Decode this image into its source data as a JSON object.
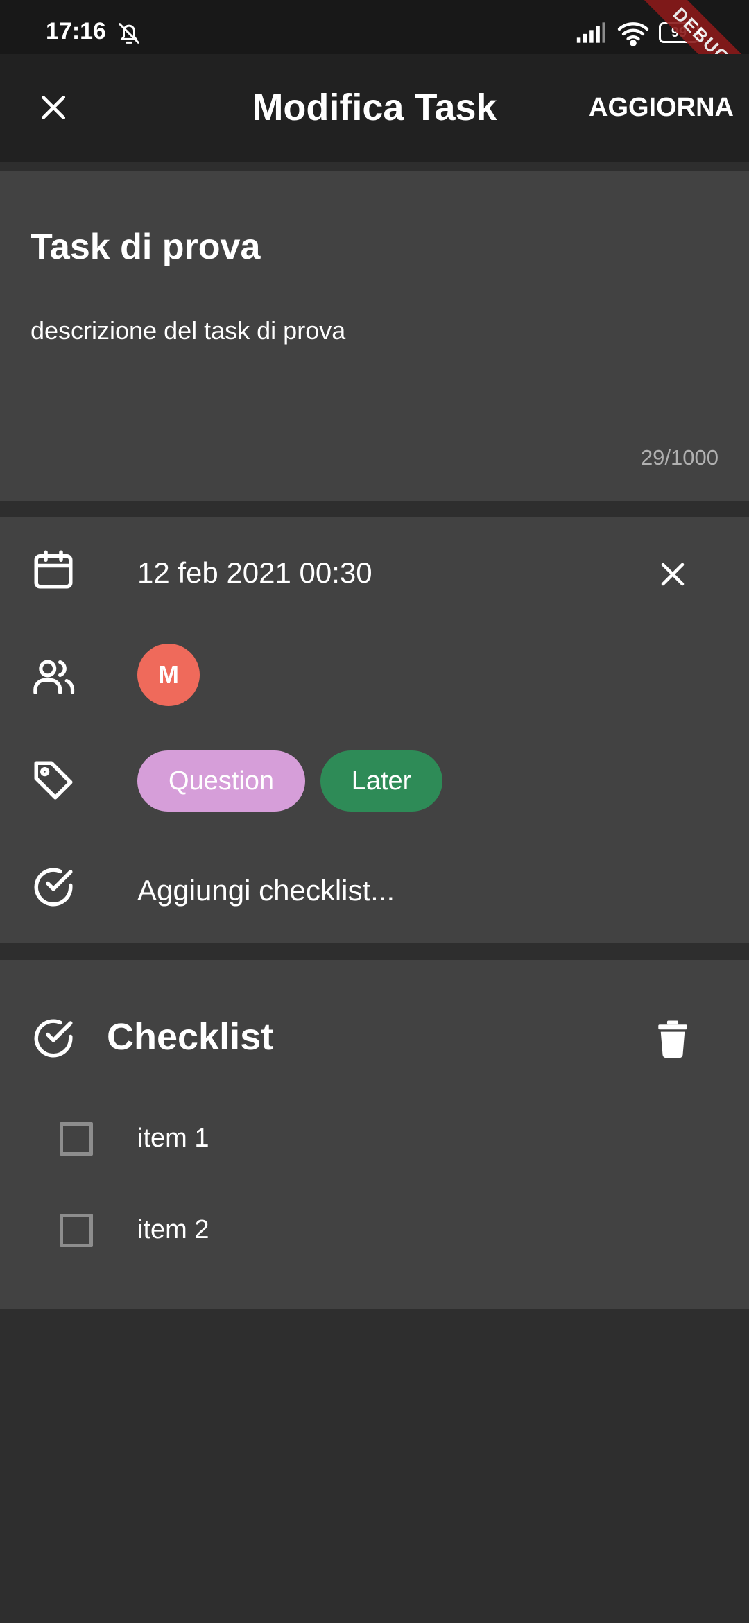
{
  "status_bar": {
    "time": "17:16",
    "battery": "99"
  },
  "debug_banner": "DEBUG",
  "app_bar": {
    "title": "Modifica Task",
    "action": "AGGIORNA"
  },
  "task": {
    "title": "Task di prova",
    "description": "descrizione del task di prova",
    "char_count": "29/1000"
  },
  "meta": {
    "date": "12 feb 2021 00:30",
    "member_initial": "M",
    "labels": [
      {
        "name": "Question",
        "color": "#d69ed9"
      },
      {
        "name": "Later",
        "color": "#2e8b57"
      }
    ],
    "add_checklist": "Aggiungi checklist..."
  },
  "checklist": {
    "title": "Checklist",
    "items": [
      {
        "label": "item 1",
        "checked": false
      },
      {
        "label": "item 2",
        "checked": false
      }
    ]
  }
}
